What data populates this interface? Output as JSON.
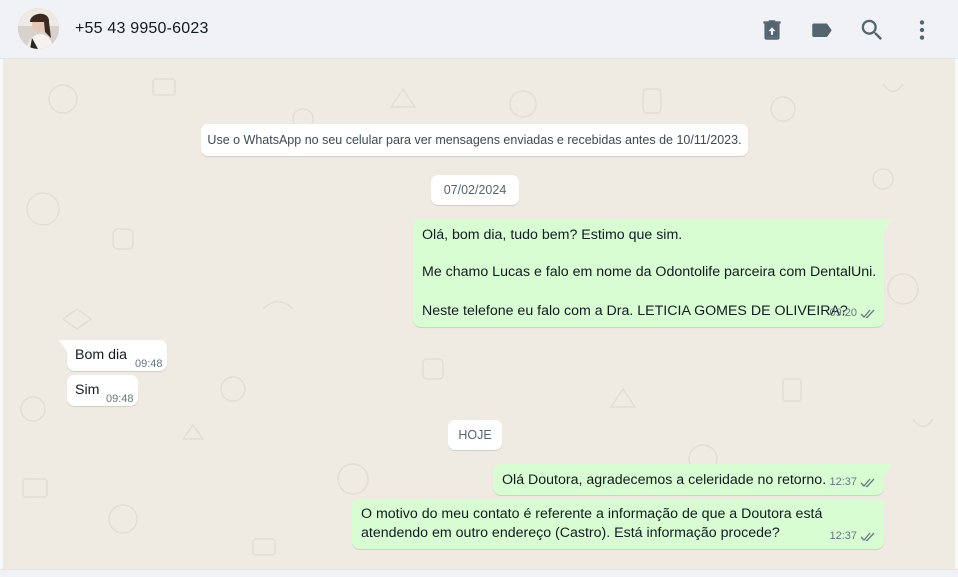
{
  "header": {
    "contact_name": "+55 43 9950-6023",
    "icons": [
      "delete-icon",
      "label-icon",
      "search-icon",
      "menu-icon"
    ]
  },
  "chat": {
    "notice": "Use o WhatsApp no seu celular para ver mensagens enviadas e recebidas antes de 10/11/2023.",
    "date_1": "07/02/2024",
    "date_2": "HOJE",
    "messages": [
      {
        "direction": "out",
        "lines": [
          "Olá, bom dia, tudo bem? Estimo que sim.",
          "Me chamo Lucas e falo em nome da Odontolife parceira com DentalUni.",
          "Neste telefone eu falo com a Dra. LETICIA GOMES DE OLIVEIRA?"
        ],
        "time": "09:20",
        "status": "read"
      },
      {
        "direction": "in",
        "text": "Bom dia",
        "time": "09:48"
      },
      {
        "direction": "in",
        "text": "Sim",
        "time": "09:48"
      },
      {
        "direction": "out",
        "text": "Olá Doutora, agradecemos a celeridade no retorno.",
        "time": "12:37",
        "status": "read"
      },
      {
        "direction": "out",
        "lines": [
          "O motivo do meu contato é referente a informação de que a Doutora está",
          "atendendo em outro endereço (Castro). Está informação procede?"
        ],
        "time": "12:37",
        "status": "read"
      }
    ]
  },
  "colors": {
    "outgoing_bubble": "#d9fdd3",
    "incoming_bubble": "#ffffff",
    "chat_background": "#efeae2",
    "header_background": "#f0f2f5",
    "read_tick": "#667781"
  }
}
